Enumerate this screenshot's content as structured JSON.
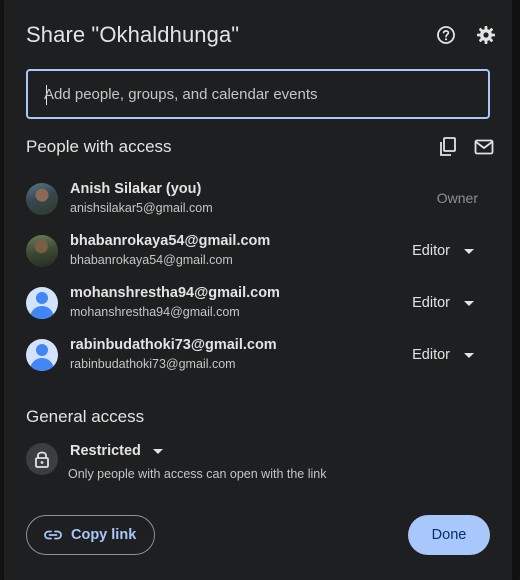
{
  "dialog": {
    "title": "Share \"Okhaldhunga\"",
    "help_icon": "help-circle-icon",
    "settings_icon": "gear-icon"
  },
  "search": {
    "placeholder": "Add people, groups, and calendar events",
    "value": ""
  },
  "people_section": {
    "title": "People with access",
    "copy_icon": "copy-emails-icon",
    "email_icon": "email-icon"
  },
  "people": [
    {
      "name": "Anish Silakar (you)",
      "email": "anishsilakar5@gmail.com",
      "role": "Owner",
      "avatar": "photo"
    },
    {
      "name": "bhabanrokaya54@gmail.com",
      "email": "bhabanrokaya54@gmail.com",
      "role": "Editor",
      "avatar": "photo"
    },
    {
      "name": "mohanshrestha94@gmail.com",
      "email": "mohanshrestha94@gmail.com",
      "role": "Editor",
      "avatar": "default"
    },
    {
      "name": "rabinbudathoki73@gmail.com",
      "email": "rabinbudathoki73@gmail.com",
      "role": "Editor",
      "avatar": "default"
    }
  ],
  "general_access": {
    "title": "General access",
    "setting": "Restricted",
    "description": "Only people with access can open with the link",
    "icon": "lock-icon"
  },
  "footer": {
    "copy_link_label": "Copy link",
    "done_label": "Done"
  },
  "colors": {
    "background": "#1e1f20",
    "accent": "#a8c7fa",
    "text": "#e3e3e3",
    "muted": "#c4c7c5"
  }
}
